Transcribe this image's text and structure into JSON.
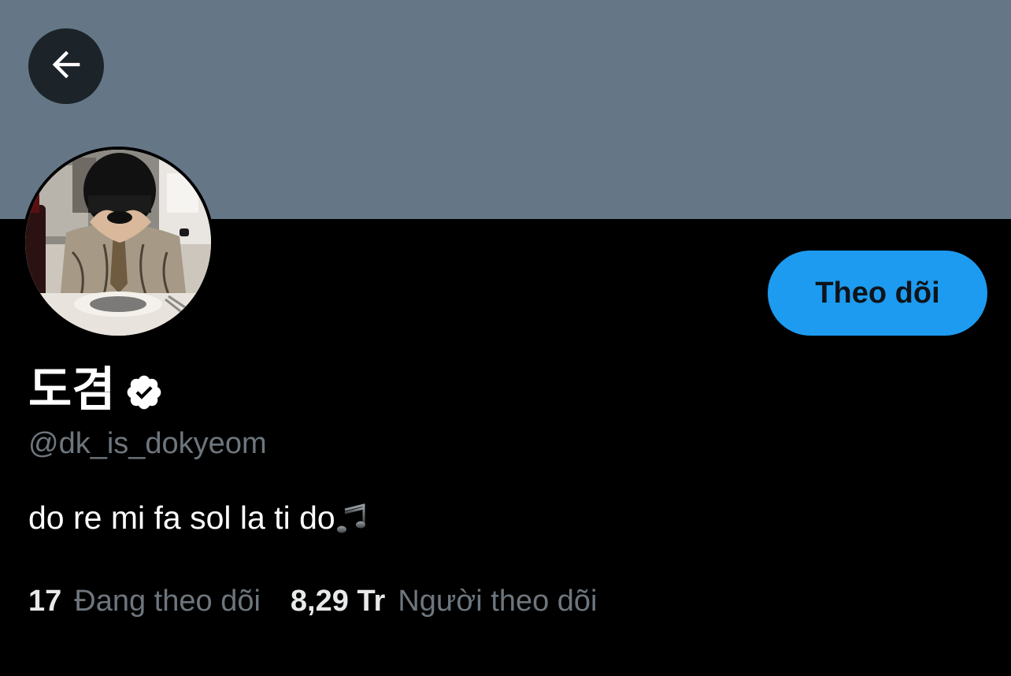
{
  "profile": {
    "display_name": "도겸",
    "handle": "@dk_is_dokyeom",
    "bio": "do re mi fa sol la ti do",
    "bio_emoji": "musical-notes",
    "verified": true
  },
  "actions": {
    "back_icon": "arrow-left-icon",
    "follow_label": "Theo dõi"
  },
  "stats": {
    "following_count": "17",
    "following_label": "Đang theo dõi",
    "followers_count": "8,29 Tr",
    "followers_label": "Người theo dõi"
  },
  "colors": {
    "banner": "#657786",
    "background": "#000000",
    "accent": "#1d9bf0",
    "secondary_text": "#6e767d",
    "primary_text": "#ffffff"
  }
}
